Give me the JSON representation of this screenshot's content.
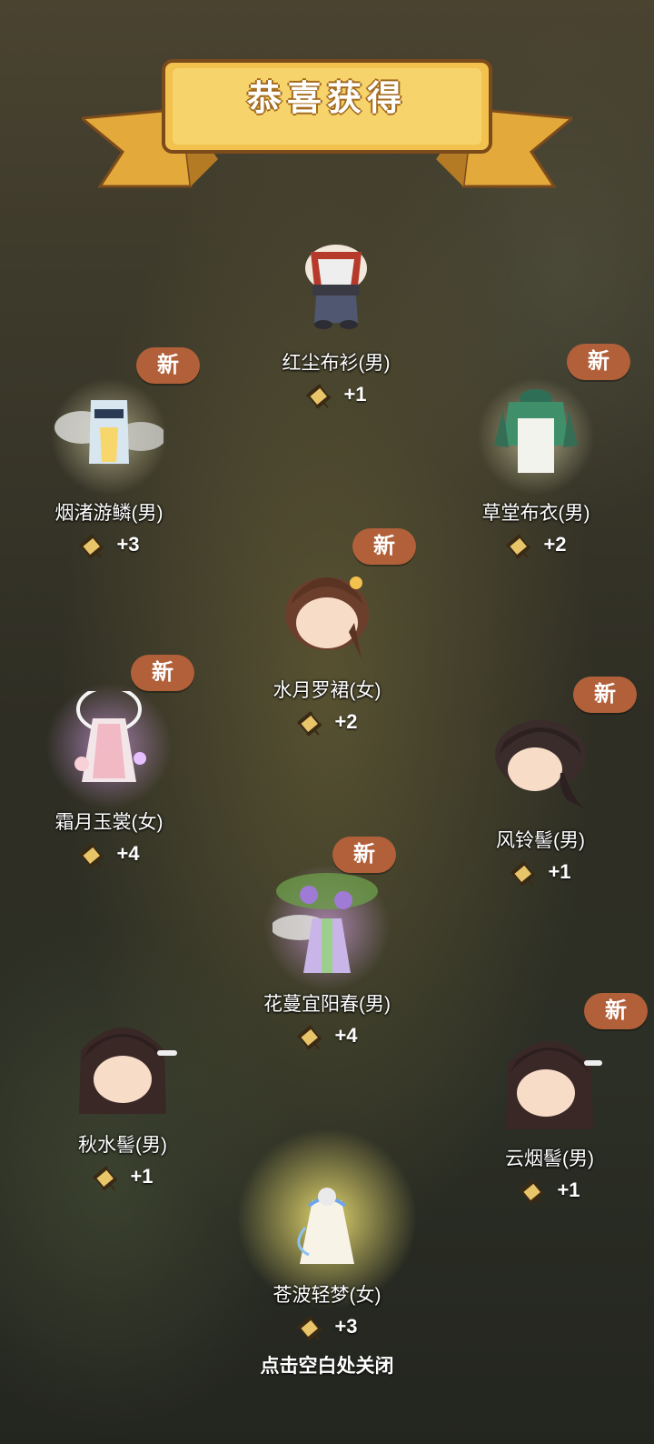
{
  "header": {
    "title": "恭喜获得"
  },
  "footer": {
    "hint": "点击空白处关闭"
  },
  "badge_label": "新",
  "items": [
    {
      "name": "红尘布衫(男)",
      "count": "+1",
      "new": false
    },
    {
      "name": "烟渚游鳞(男)",
      "count": "+3",
      "new": true
    },
    {
      "name": "草堂布衣(男)",
      "count": "+2",
      "new": true
    },
    {
      "name": "水月罗裙(女)",
      "count": "+2",
      "new": true
    },
    {
      "name": "霜月玉裳(女)",
      "count": "+4",
      "new": true
    },
    {
      "name": "风铃髻(男)",
      "count": "+1",
      "new": true
    },
    {
      "name": "花蔓宜阳春(男)",
      "count": "+4",
      "new": true
    },
    {
      "name": "秋水髻(男)",
      "count": "+1",
      "new": false
    },
    {
      "name": "云烟髻(男)",
      "count": "+1",
      "new": true
    },
    {
      "name": "苍波轻梦(女)",
      "count": "+3",
      "new": false
    }
  ],
  "colors": {
    "banner": "#f2c14e",
    "badge": "#b2603a"
  }
}
